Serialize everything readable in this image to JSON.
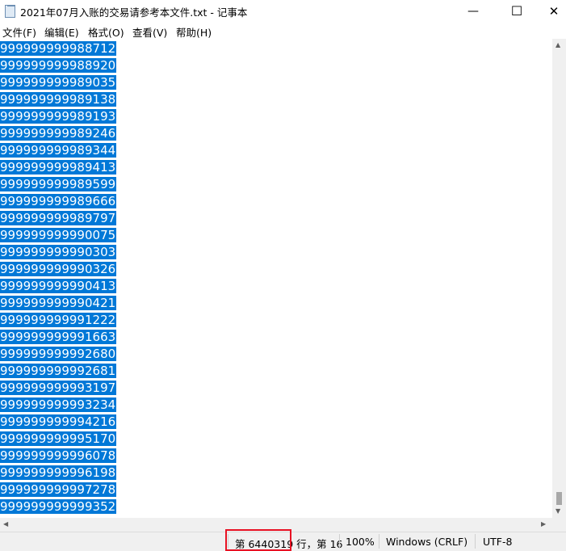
{
  "window": {
    "title": "2021年07月入账的交易请参考本文件.txt - 记事本",
    "minimize": "—",
    "maximize": "☐",
    "close": "✕"
  },
  "menu": [
    "文件(F)",
    "编辑(E)",
    "格式(O)",
    "查看(V)",
    "帮助(H)"
  ],
  "lines": [
    "999999999988712",
    "999999999988920",
    "999999999989035",
    "999999999989138",
    "999999999989193",
    "999999999989246",
    "999999999989344",
    "999999999989413",
    "999999999989599",
    "999999999989666",
    "999999999989797",
    "999999999990075",
    "999999999990303",
    "999999999990326",
    "999999999990413",
    "999999999990421",
    "999999999991222",
    "999999999991663",
    "999999999992680",
    "999999999992681",
    "999999999993197",
    "999999999993234",
    "999999999994216",
    "999999999995170",
    "999999999996078",
    "999999999996198",
    "999999999997278",
    "999999999999352"
  ],
  "status": {
    "position": "第 6440319 行，第 16",
    "zoom": "100%",
    "line_ending": "Windows (CRLF)",
    "encoding": "UTF-8"
  },
  "colors": {
    "selection": "#0078d7",
    "highlight": "#e81123"
  }
}
